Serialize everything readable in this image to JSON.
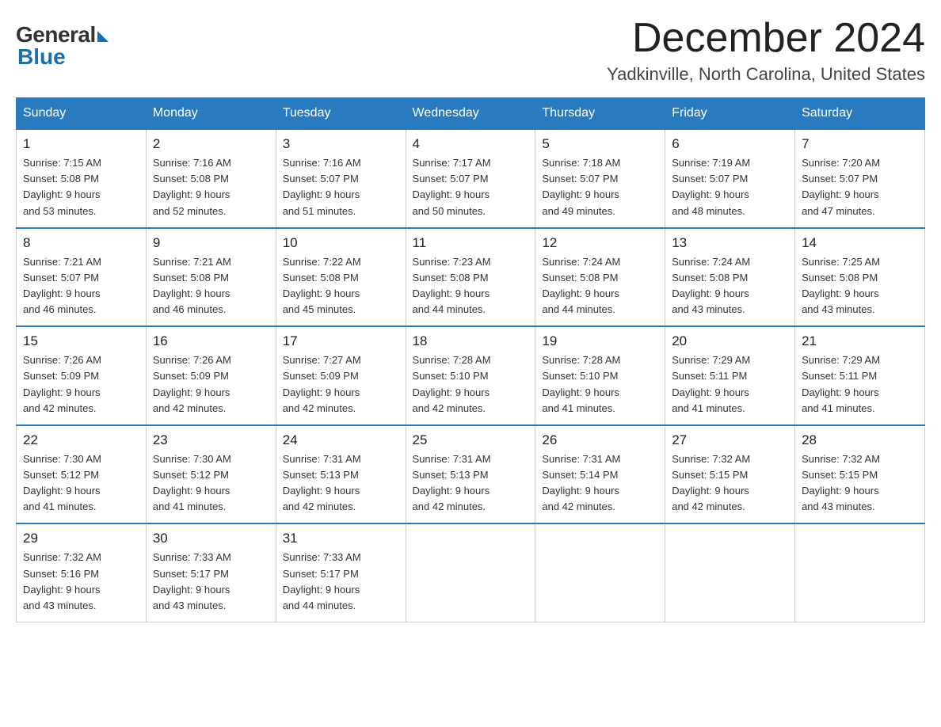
{
  "header": {
    "logo_general": "General",
    "logo_blue": "Blue",
    "main_title": "December 2024",
    "subtitle": "Yadkinville, North Carolina, United States"
  },
  "weekdays": [
    "Sunday",
    "Monday",
    "Tuesday",
    "Wednesday",
    "Thursday",
    "Friday",
    "Saturday"
  ],
  "weeks": [
    [
      {
        "day": "1",
        "sunrise": "7:15 AM",
        "sunset": "5:08 PM",
        "daylight": "9 hours and 53 minutes."
      },
      {
        "day": "2",
        "sunrise": "7:16 AM",
        "sunset": "5:08 PM",
        "daylight": "9 hours and 52 minutes."
      },
      {
        "day": "3",
        "sunrise": "7:16 AM",
        "sunset": "5:07 PM",
        "daylight": "9 hours and 51 minutes."
      },
      {
        "day": "4",
        "sunrise": "7:17 AM",
        "sunset": "5:07 PM",
        "daylight": "9 hours and 50 minutes."
      },
      {
        "day": "5",
        "sunrise": "7:18 AM",
        "sunset": "5:07 PM",
        "daylight": "9 hours and 49 minutes."
      },
      {
        "day": "6",
        "sunrise": "7:19 AM",
        "sunset": "5:07 PM",
        "daylight": "9 hours and 48 minutes."
      },
      {
        "day": "7",
        "sunrise": "7:20 AM",
        "sunset": "5:07 PM",
        "daylight": "9 hours and 47 minutes."
      }
    ],
    [
      {
        "day": "8",
        "sunrise": "7:21 AM",
        "sunset": "5:07 PM",
        "daylight": "9 hours and 46 minutes."
      },
      {
        "day": "9",
        "sunrise": "7:21 AM",
        "sunset": "5:08 PM",
        "daylight": "9 hours and 46 minutes."
      },
      {
        "day": "10",
        "sunrise": "7:22 AM",
        "sunset": "5:08 PM",
        "daylight": "9 hours and 45 minutes."
      },
      {
        "day": "11",
        "sunrise": "7:23 AM",
        "sunset": "5:08 PM",
        "daylight": "9 hours and 44 minutes."
      },
      {
        "day": "12",
        "sunrise": "7:24 AM",
        "sunset": "5:08 PM",
        "daylight": "9 hours and 44 minutes."
      },
      {
        "day": "13",
        "sunrise": "7:24 AM",
        "sunset": "5:08 PM",
        "daylight": "9 hours and 43 minutes."
      },
      {
        "day": "14",
        "sunrise": "7:25 AM",
        "sunset": "5:08 PM",
        "daylight": "9 hours and 43 minutes."
      }
    ],
    [
      {
        "day": "15",
        "sunrise": "7:26 AM",
        "sunset": "5:09 PM",
        "daylight": "9 hours and 42 minutes."
      },
      {
        "day": "16",
        "sunrise": "7:26 AM",
        "sunset": "5:09 PM",
        "daylight": "9 hours and 42 minutes."
      },
      {
        "day": "17",
        "sunrise": "7:27 AM",
        "sunset": "5:09 PM",
        "daylight": "9 hours and 42 minutes."
      },
      {
        "day": "18",
        "sunrise": "7:28 AM",
        "sunset": "5:10 PM",
        "daylight": "9 hours and 42 minutes."
      },
      {
        "day": "19",
        "sunrise": "7:28 AM",
        "sunset": "5:10 PM",
        "daylight": "9 hours and 41 minutes."
      },
      {
        "day": "20",
        "sunrise": "7:29 AM",
        "sunset": "5:11 PM",
        "daylight": "9 hours and 41 minutes."
      },
      {
        "day": "21",
        "sunrise": "7:29 AM",
        "sunset": "5:11 PM",
        "daylight": "9 hours and 41 minutes."
      }
    ],
    [
      {
        "day": "22",
        "sunrise": "7:30 AM",
        "sunset": "5:12 PM",
        "daylight": "9 hours and 41 minutes."
      },
      {
        "day": "23",
        "sunrise": "7:30 AM",
        "sunset": "5:12 PM",
        "daylight": "9 hours and 41 minutes."
      },
      {
        "day": "24",
        "sunrise": "7:31 AM",
        "sunset": "5:13 PM",
        "daylight": "9 hours and 42 minutes."
      },
      {
        "day": "25",
        "sunrise": "7:31 AM",
        "sunset": "5:13 PM",
        "daylight": "9 hours and 42 minutes."
      },
      {
        "day": "26",
        "sunrise": "7:31 AM",
        "sunset": "5:14 PM",
        "daylight": "9 hours and 42 minutes."
      },
      {
        "day": "27",
        "sunrise": "7:32 AM",
        "sunset": "5:15 PM",
        "daylight": "9 hours and 42 minutes."
      },
      {
        "day": "28",
        "sunrise": "7:32 AM",
        "sunset": "5:15 PM",
        "daylight": "9 hours and 43 minutes."
      }
    ],
    [
      {
        "day": "29",
        "sunrise": "7:32 AM",
        "sunset": "5:16 PM",
        "daylight": "9 hours and 43 minutes."
      },
      {
        "day": "30",
        "sunrise": "7:33 AM",
        "sunset": "5:17 PM",
        "daylight": "9 hours and 43 minutes."
      },
      {
        "day": "31",
        "sunrise": "7:33 AM",
        "sunset": "5:17 PM",
        "daylight": "9 hours and 44 minutes."
      },
      null,
      null,
      null,
      null
    ]
  ],
  "labels": {
    "sunrise": "Sunrise:",
    "sunset": "Sunset:",
    "daylight": "Daylight:"
  }
}
